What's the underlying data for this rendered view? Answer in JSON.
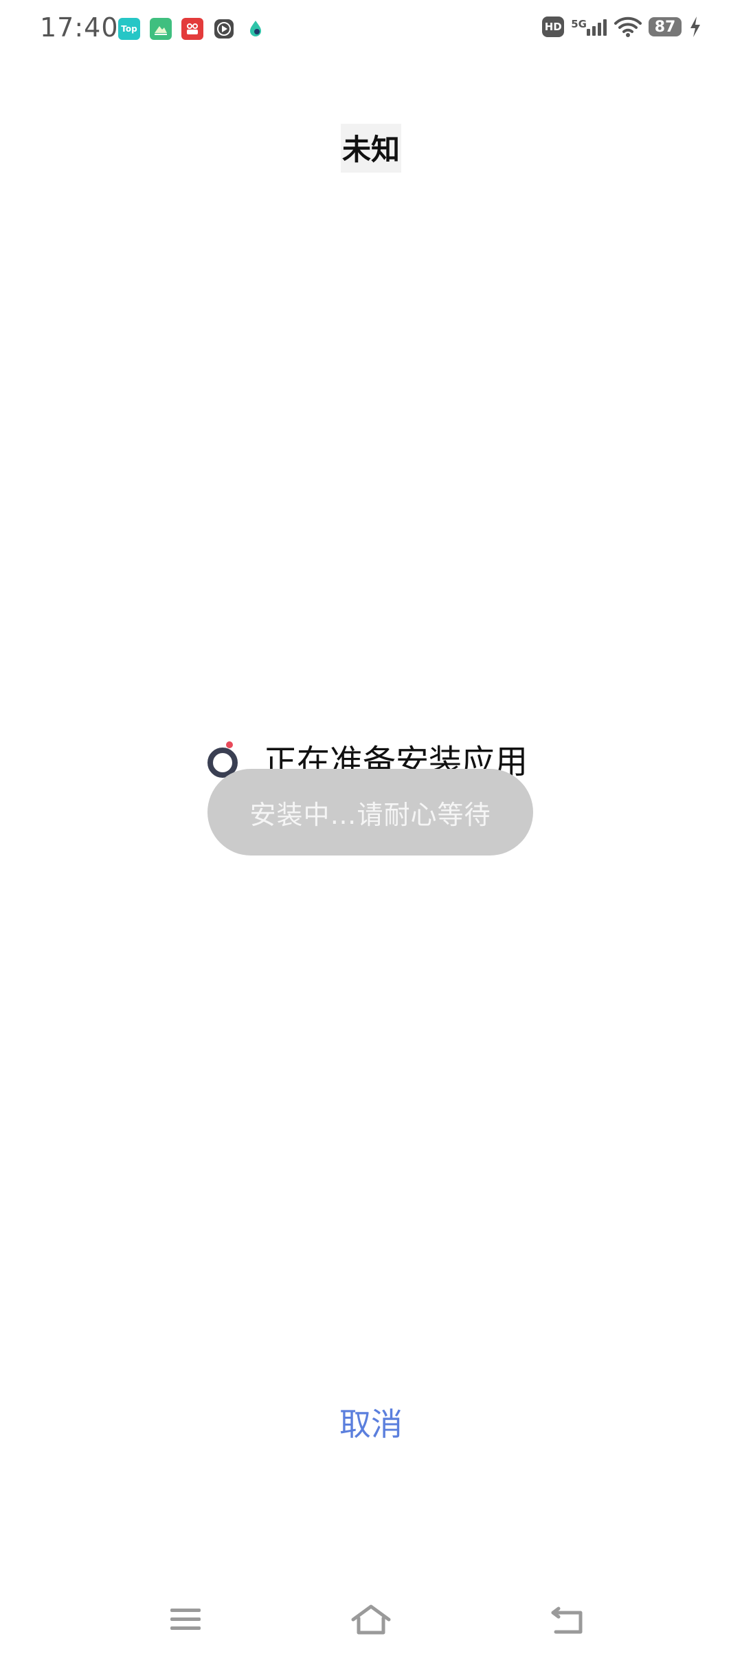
{
  "status_bar": {
    "time": "17:40",
    "notification_icons": [
      {
        "name": "top-app-icon",
        "label": "Top"
      },
      {
        "name": "map-app-icon",
        "label": ""
      },
      {
        "name": "red-app-icon",
        "label": ""
      },
      {
        "name": "video-play-icon",
        "label": ""
      },
      {
        "name": "water-drop-app-icon",
        "label": ""
      }
    ],
    "hd_label": "HD",
    "network_type": "5G",
    "battery_level": "87"
  },
  "installer": {
    "app_name": "未知",
    "progress_text": "正在准备安装应用",
    "toast_text": "安装中…请耐心等待",
    "cancel_label": "取消"
  },
  "colors": {
    "accent": "#5b7fdd",
    "spinner_dot": "#e84a5a",
    "spinner_ring": "#3a3f52",
    "toast_bg": "#cbcbcb"
  },
  "nav_bar": {
    "buttons": [
      "menu-icon",
      "home-icon",
      "back-icon"
    ]
  }
}
